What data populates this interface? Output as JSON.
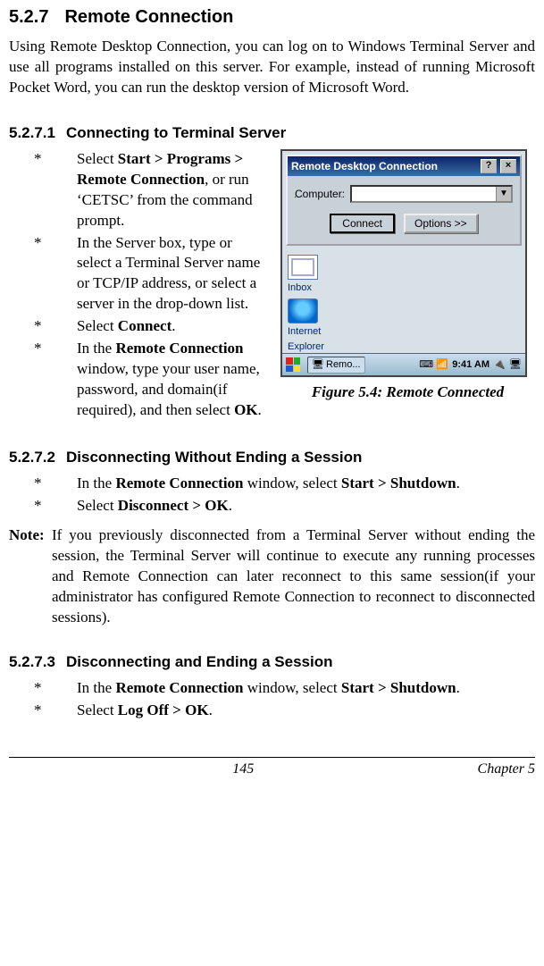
{
  "section": {
    "num": "5.2.7",
    "title": "Remote Connection"
  },
  "intro": "Using Remote Desktop Connection, you can log on to Windows Terminal Server and use all programs installed on this server. For example, instead of running Microsoft Pocket Word, you can run the desktop version of Microsoft Word.",
  "sub1": {
    "num": "5.2.7.1",
    "title": "Connecting to Terminal Server"
  },
  "steps1": {
    "a_pre": "Select ",
    "a_bold": "Start > Programs > Remote Connection",
    "a_post": ", or run ‘CETSC’ from the command prompt.",
    "b": "In the Server box, type or select a Terminal Server name or TCP/IP address, or select a server in the drop-down list.",
    "c_pre": "Select ",
    "c_bold": "Connect",
    "c_post": ".",
    "d_pre": "In the ",
    "d_bold1": "Remote Connection",
    "d_mid": " window, type your user name, password, and domain(if required), and then select ",
    "d_bold2": "OK",
    "d_post": "."
  },
  "figure": {
    "caption": "Figure 5.4: Remote Connected"
  },
  "shot": {
    "title": "Remote Desktop Connection",
    "computer_label": "Computer:",
    "value": "",
    "connect": "Connect",
    "options": "Options >>",
    "inbox": "Inbox",
    "ie1": "Internet",
    "ie2": "Explorer",
    "task": "Remo...",
    "time": "9:41 AM"
  },
  "sub2": {
    "num": "5.2.7.2",
    "title": "Disconnecting Without Ending a Session"
  },
  "steps2": {
    "a_pre": "In the ",
    "a_b1": "Remote Connection",
    "a_mid": " window, select ",
    "a_b2": "Start > Shutdown",
    "a_post": ".",
    "b_pre": "Select ",
    "b_b1": "Disconnect > OK",
    "b_post": "."
  },
  "note": {
    "label": "Note:",
    "body": "If you previously disconnected from a Terminal Server without ending the session, the Terminal Server will continue to execute any running processes and Remote Connection can later reconnect to this same session(if your administrator has configured Remote Connection to reconnect to disconnected sessions)."
  },
  "sub3": {
    "num": "5.2.7.3",
    "title": "Disconnecting and Ending a Session"
  },
  "steps3": {
    "a_pre": "In the ",
    "a_b1": "Remote Connection",
    "a_mid": " window, select ",
    "a_b2": "Start > Shutdown",
    "a_post": ".",
    "b_pre": "Select ",
    "b_b1": "Log Off > OK",
    "b_post": "."
  },
  "footer": {
    "page": "145",
    "chapter": "Chapter 5"
  }
}
